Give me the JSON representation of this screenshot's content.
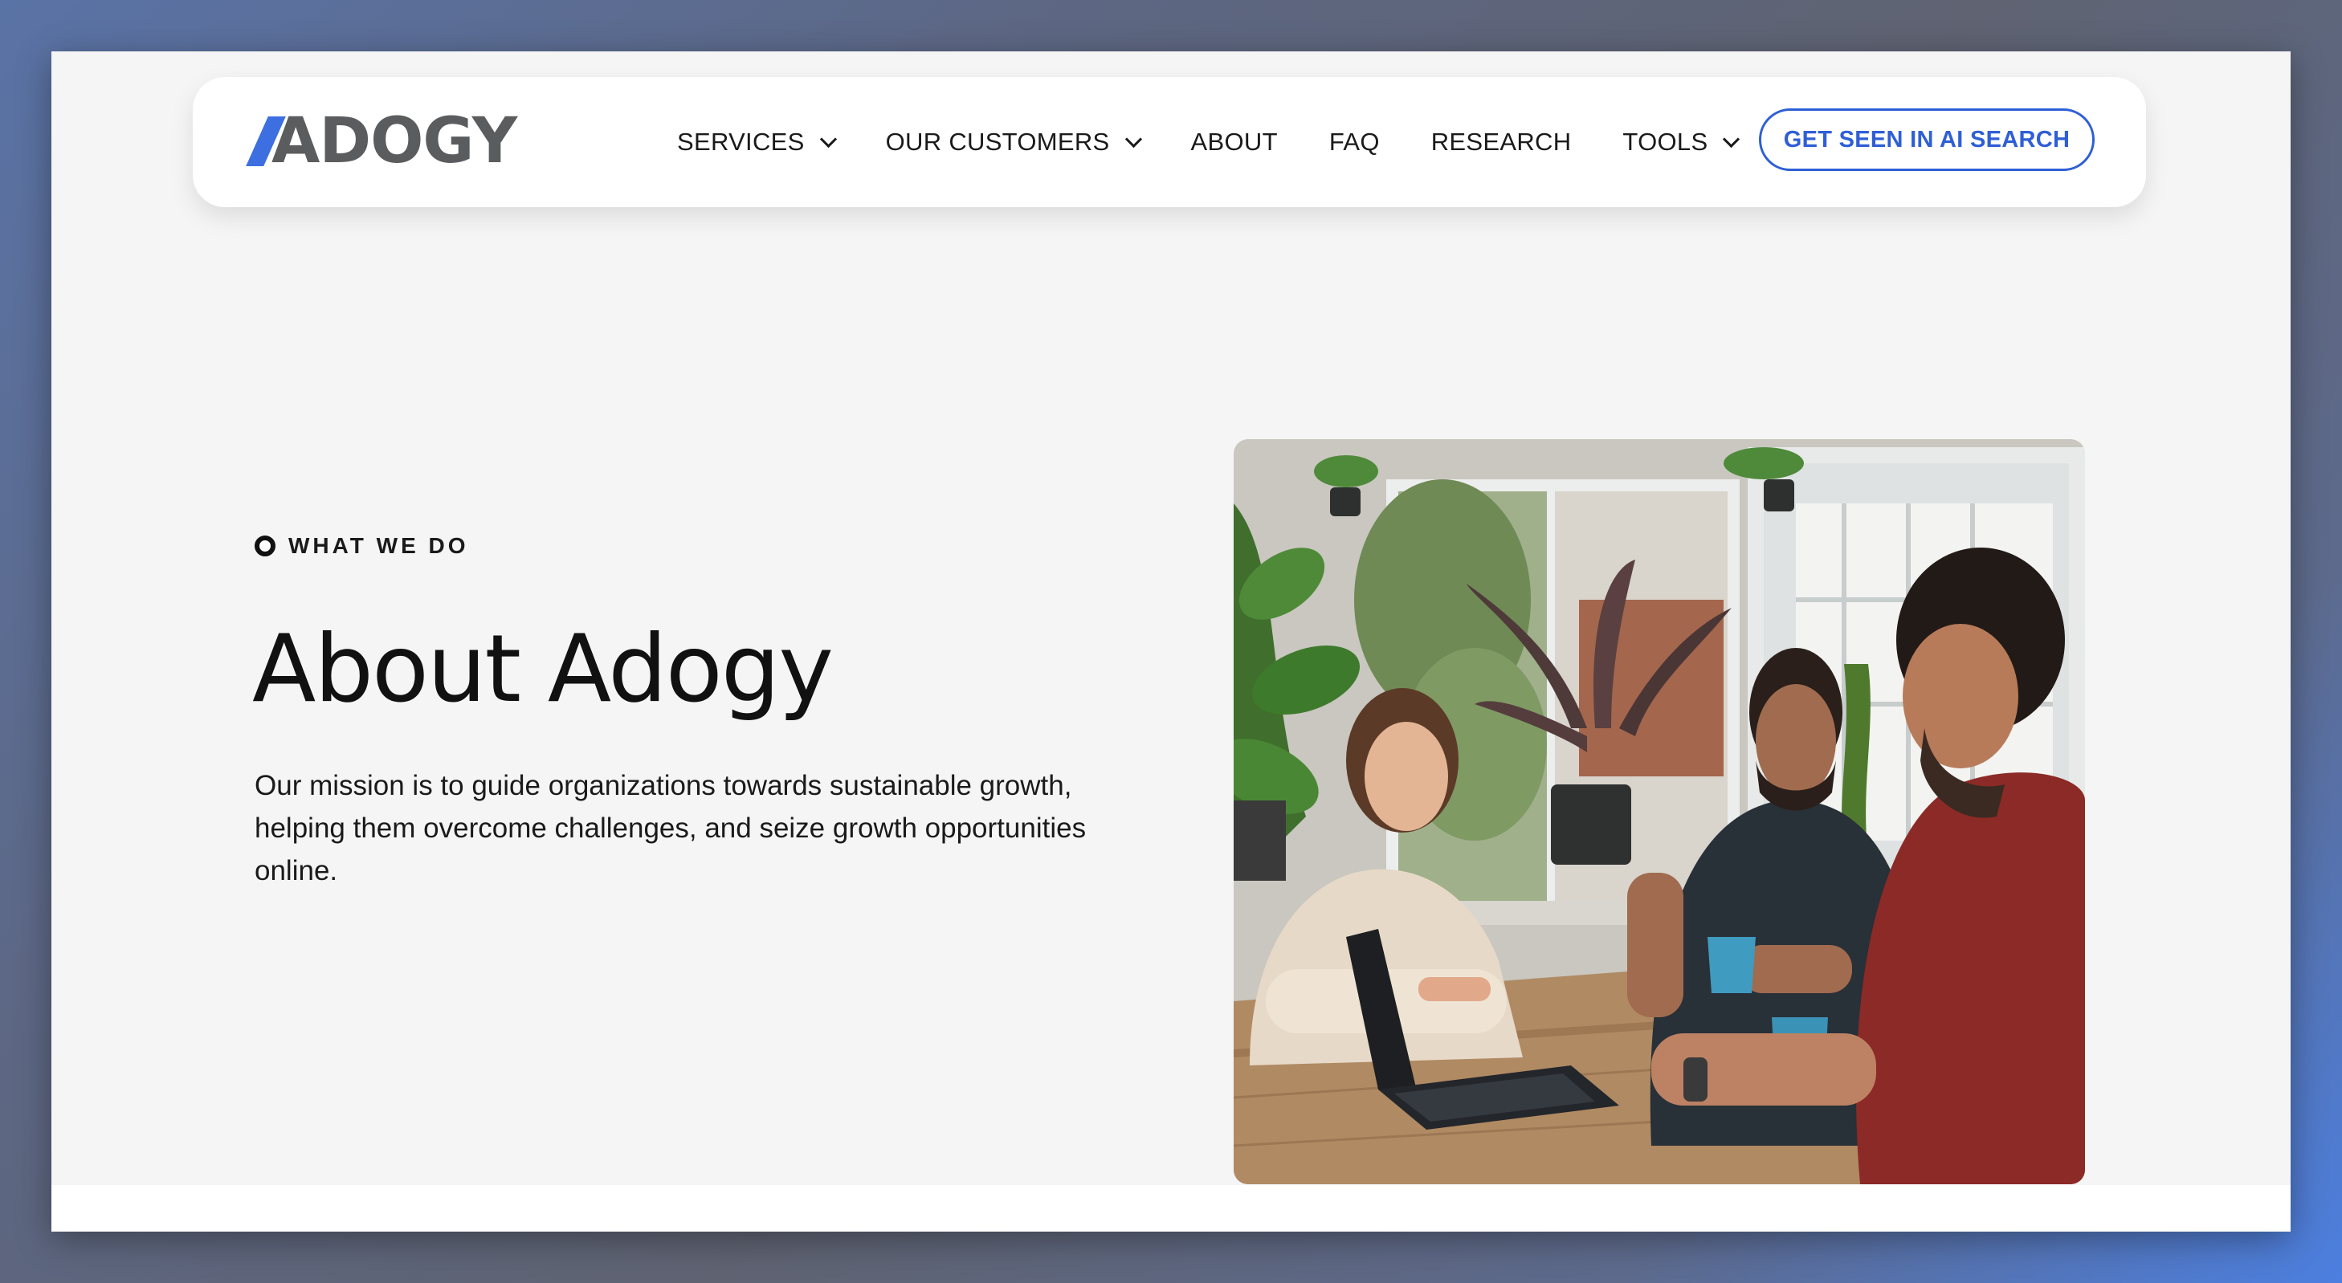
{
  "brand": {
    "logo_text": "ADOGY",
    "accent": "#2f5fd6",
    "logo_color": "#5b5c5e"
  },
  "nav": {
    "items": [
      {
        "label": "SERVICES",
        "has_dropdown": true
      },
      {
        "label": "OUR CUSTOMERS",
        "has_dropdown": true
      },
      {
        "label": "ABOUT",
        "has_dropdown": false
      },
      {
        "label": "FAQ",
        "has_dropdown": false
      },
      {
        "label": "RESEARCH",
        "has_dropdown": false
      },
      {
        "label": "TOOLS",
        "has_dropdown": true
      }
    ],
    "cta_label": "GET SEEN IN AI SEARCH"
  },
  "hero": {
    "eyebrow": "WHAT WE DO",
    "title": "About Adogy",
    "description": "Our mission is to guide organizations towards sustainable growth, helping them overcome challenges, and seize growth opportunities online."
  },
  "icons": {
    "dropdown": "chevron-down-icon",
    "eyebrow": "circle-dot-icon",
    "logo": "logo-slash-icon"
  }
}
